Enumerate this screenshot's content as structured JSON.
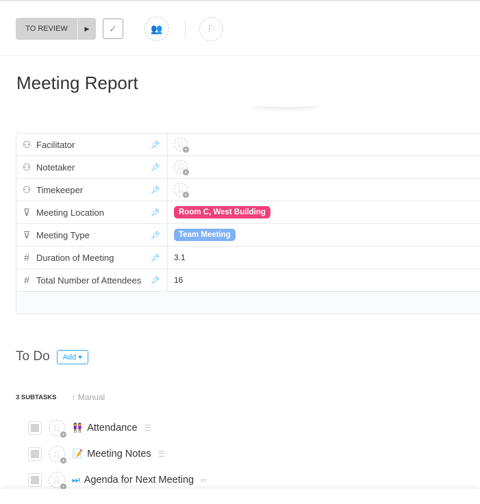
{
  "toolbar": {
    "status": "TO REVIEW",
    "status_color": "#d3d3d3"
  },
  "title": "Meeting Report",
  "fields": [
    {
      "name": "Facilitator",
      "icon": "user-icon",
      "value": ""
    },
    {
      "name": "Notetaker",
      "icon": "user-icon",
      "value": ""
    },
    {
      "name": "Timekeeper",
      "icon": "user-icon",
      "value": ""
    },
    {
      "name": "Meeting Location",
      "icon": "dropdown-icon",
      "value": "Room C, West Building",
      "color": "#f0407b"
    },
    {
      "name": "Meeting Type",
      "icon": "dropdown-icon",
      "value": "Team Meeting",
      "color": "#7fb1f5"
    },
    {
      "name": "Duration of Meeting",
      "icon": "number-icon",
      "value": "3.1"
    },
    {
      "name": "Total Number of Attendees",
      "icon": "number-icon",
      "value": "16"
    }
  ],
  "todo": {
    "label": "To Do",
    "add": "Add"
  },
  "subtasks": {
    "count_label": "3 SUBTASKS",
    "sort": "Manual",
    "items": [
      {
        "emoji": "👭",
        "name": "Attendance"
      },
      {
        "emoji": "📝",
        "name": "Meeting Notes"
      },
      {
        "emoji": "⏭",
        "name": "Agenda for Next Meeting"
      }
    ]
  }
}
